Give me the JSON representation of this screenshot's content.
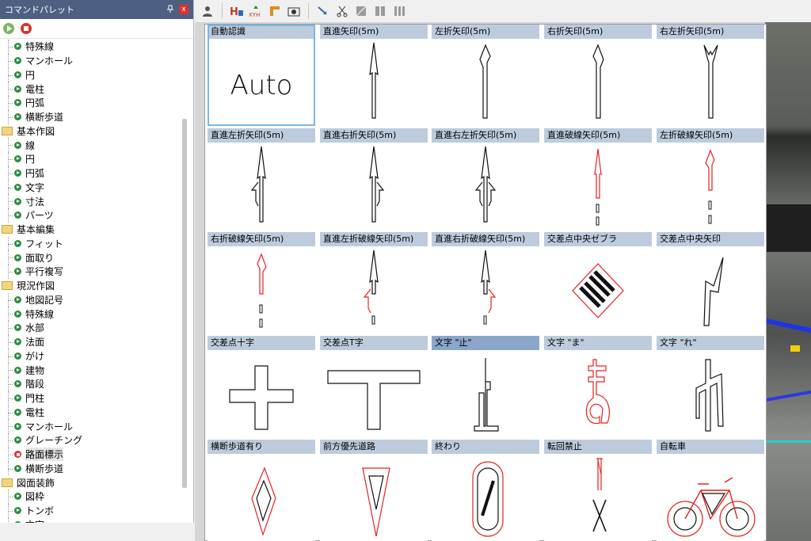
{
  "palette": {
    "title": "コマンドパレット",
    "pin_label": "ꟸ",
    "close_label": "x",
    "items": [
      {
        "label": "特殊線",
        "type": "child"
      },
      {
        "label": "マンホール",
        "type": "child"
      },
      {
        "label": "円",
        "type": "child"
      },
      {
        "label": "電柱",
        "type": "child"
      },
      {
        "label": "円弧",
        "type": "child"
      },
      {
        "label": "横断歩道",
        "type": "child"
      },
      {
        "label": "基本作図",
        "type": "folder"
      },
      {
        "label": "線",
        "type": "child"
      },
      {
        "label": "円",
        "type": "child"
      },
      {
        "label": "円弧",
        "type": "child"
      },
      {
        "label": "文字",
        "type": "child"
      },
      {
        "label": "寸法",
        "type": "child"
      },
      {
        "label": "パーツ",
        "type": "child"
      },
      {
        "label": "基本編集",
        "type": "folder"
      },
      {
        "label": "フィット",
        "type": "child"
      },
      {
        "label": "面取り",
        "type": "child"
      },
      {
        "label": "平行複写",
        "type": "child"
      },
      {
        "label": "現況作図",
        "type": "folder"
      },
      {
        "label": "地図記号",
        "type": "child"
      },
      {
        "label": "特殊線",
        "type": "child"
      },
      {
        "label": "水部",
        "type": "child"
      },
      {
        "label": "法面",
        "type": "child"
      },
      {
        "label": "がけ",
        "type": "child"
      },
      {
        "label": "建物",
        "type": "child"
      },
      {
        "label": "階段",
        "type": "child"
      },
      {
        "label": "門柱",
        "type": "child"
      },
      {
        "label": "電柱",
        "type": "child"
      },
      {
        "label": "マンホール",
        "type": "child"
      },
      {
        "label": "グレーチング",
        "type": "child"
      },
      {
        "label": "路面標示",
        "type": "child-red"
      },
      {
        "label": "横断歩道",
        "type": "child"
      },
      {
        "label": "図面装飾",
        "type": "folder"
      },
      {
        "label": "図枠",
        "type": "child"
      },
      {
        "label": "トンボ",
        "type": "child"
      },
      {
        "label": "文字",
        "type": "child"
      }
    ]
  },
  "gallery": {
    "cells": [
      {
        "label": "自動認識",
        "auto_text": "Auto"
      },
      {
        "label": "直進矢印(5m)"
      },
      {
        "label": "左折矢印(5m)"
      },
      {
        "label": "右折矢印(5m)"
      },
      {
        "label": "右左折矢印(5m)"
      },
      {
        "label": "直進左折矢印(5m)"
      },
      {
        "label": "直進右折矢印(5m)"
      },
      {
        "label": "直進右左折矢印(5m)"
      },
      {
        "label": "直進破線矢印(5m)"
      },
      {
        "label": "左折破線矢印(5m)"
      },
      {
        "label": "右折破線矢印(5m)"
      },
      {
        "label": "直進左折破線矢印(5m)"
      },
      {
        "label": "直進右折破線矢印(5m)"
      },
      {
        "label": "交差点中央ゼブラ"
      },
      {
        "label": "交差点中央矢印"
      },
      {
        "label": "交差点十字"
      },
      {
        "label": "交差点T字"
      },
      {
        "label": "文字 \"止\""
      },
      {
        "label": "文字 \"ま\""
      },
      {
        "label": "文字 \"れ\""
      },
      {
        "label": "横断歩道有り"
      },
      {
        "label": "前方優先道路"
      },
      {
        "label": "終わり"
      },
      {
        "label": "転回禁止"
      },
      {
        "label": "自転車"
      }
    ]
  },
  "colors": {
    "accent_red": "#e4231f",
    "selected_header": "#8aa6c9",
    "header": "#bdccdc",
    "title_bar": "#4d6082"
  }
}
